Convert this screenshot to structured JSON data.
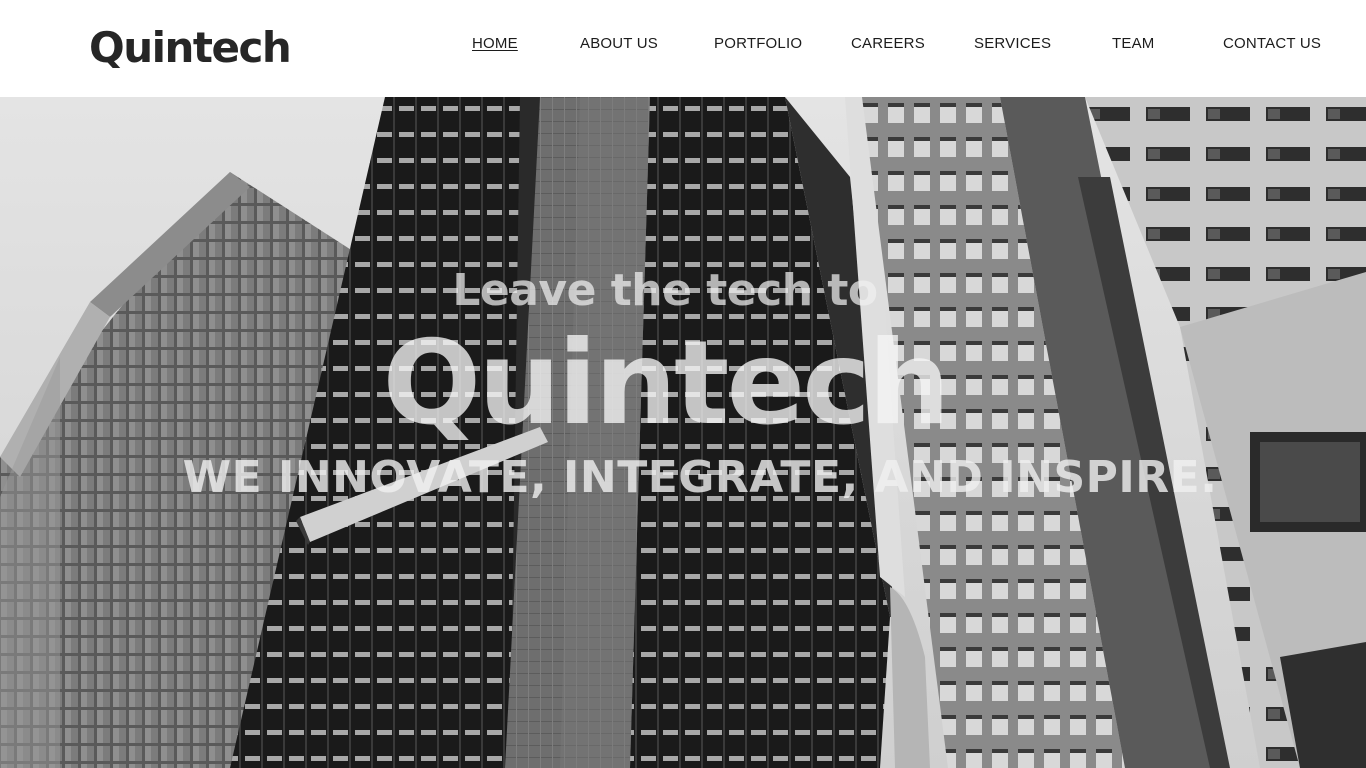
{
  "header": {
    "logo": "Quintech",
    "nav": [
      {
        "label": "HOME",
        "active": true
      },
      {
        "label": "ABOUT US",
        "active": false
      },
      {
        "label": "PORTFOLIO",
        "active": false
      },
      {
        "label": "CAREERS",
        "active": false
      },
      {
        "label": "SERVICES",
        "active": false
      },
      {
        "label": "TEAM",
        "active": false
      },
      {
        "label": "CONTACT US",
        "active": false
      }
    ]
  },
  "hero": {
    "tagline": "Leave the tech to",
    "brand": "Quintech",
    "motto": "WE INNOVATE, INTEGRATE, AND INSPIRE.",
    "background": "black-and-white-skyscrapers-photo"
  },
  "colors": {
    "header_bg": "#ffffff",
    "text_dark": "#262626",
    "hero_text": "#f0f0f0"
  }
}
